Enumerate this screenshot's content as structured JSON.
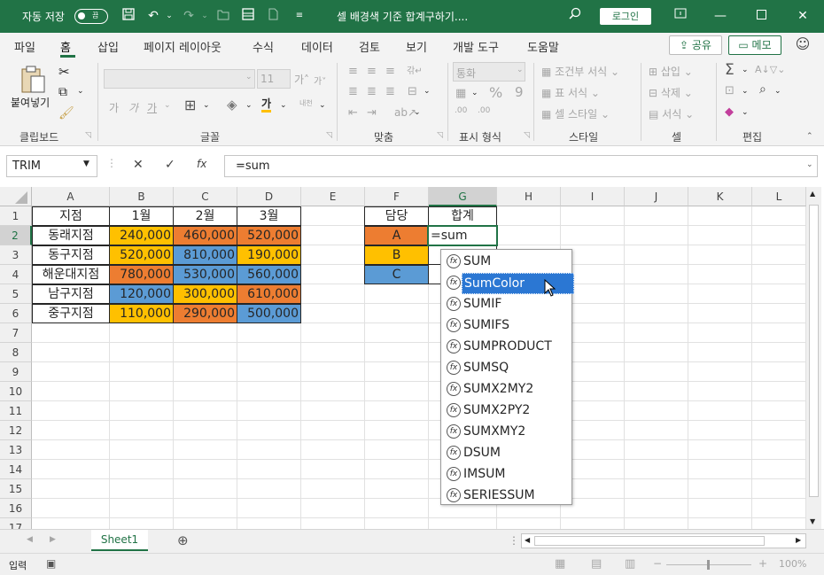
{
  "titlebar": {
    "autosave_label": "자동 저장",
    "autosave_state": "끔",
    "doc_title": "셀 배경색 기준 합계구하기....",
    "login_label": "로그인"
  },
  "tabs": [
    "파일",
    "홈",
    "삽입",
    "페이지 레이아웃",
    "수식",
    "데이터",
    "검토",
    "보기",
    "개발 도구",
    "도움말"
  ],
  "share_label": "공유",
  "memo_label": "메모",
  "ribbon": {
    "clipboard": {
      "paste_label": "붙여넣기",
      "group_label": "클립보드"
    },
    "font": {
      "font_size": "11",
      "group_label": "글꼴"
    },
    "align": {
      "group_label": "맞춤"
    },
    "number": {
      "format": "통화",
      "group_label": "표시 형식"
    },
    "styles": {
      "cond_format": "조건부 서식",
      "table_format": "표 서식",
      "cell_style": "셀 스타일",
      "group_label": "스타일"
    },
    "cells": {
      "insert": "삽입",
      "delete": "삭제",
      "format": "서식",
      "group_label": "셀"
    },
    "edit": {
      "group_label": "편집"
    }
  },
  "formula_bar": {
    "name_box": "TRIM",
    "formula": "=sum"
  },
  "columns": [
    "A",
    "B",
    "C",
    "D",
    "E",
    "F",
    "G",
    "H",
    "I",
    "J",
    "K",
    "L"
  ],
  "rows": [
    "1",
    "2",
    "3",
    "4",
    "5",
    "6",
    "7",
    "8",
    "9",
    "10",
    "11",
    "12",
    "13",
    "14",
    "15",
    "16",
    "17"
  ],
  "table": {
    "headers": [
      "지점",
      "1월",
      "2월",
      "3월"
    ],
    "rows": [
      {
        "name": "동래지점",
        "m1": "240,000",
        "m2": "460,000",
        "m3": "520,000"
      },
      {
        "name": "동구지점",
        "m1": "520,000",
        "m2": "810,000",
        "m3": "190,000"
      },
      {
        "name": "해운대지점",
        "m1": "780,000",
        "m2": "530,000",
        "m3": "560,000"
      },
      {
        "name": "남구지점",
        "m1": "120,000",
        "m2": "300,000",
        "m3": "610,000"
      },
      {
        "name": "중구지점",
        "m1": "110,000",
        "m2": "290,000",
        "m3": "500,000"
      }
    ]
  },
  "summary": {
    "header_owner": "담당",
    "header_total": "합계",
    "owners": [
      "A",
      "B",
      "C"
    ],
    "editing_value": "=sum"
  },
  "autocomplete": [
    "SUM",
    "SumColor",
    "SUMIF",
    "SUMIFS",
    "SUMPRODUCT",
    "SUMSQ",
    "SUMX2MY2",
    "SUMX2PY2",
    "SUMXMY2",
    "DSUM",
    "IMSUM",
    "SERIESSUM"
  ],
  "autocomplete_selected": "SumColor",
  "colors": {
    "orange": "#ed7d31",
    "yellow": "#ffc000",
    "blue": "#5b9bd5",
    "excel_green": "#217346"
  },
  "sheet_tab": "Sheet1",
  "status": {
    "mode": "입력",
    "zoom": "100%"
  }
}
